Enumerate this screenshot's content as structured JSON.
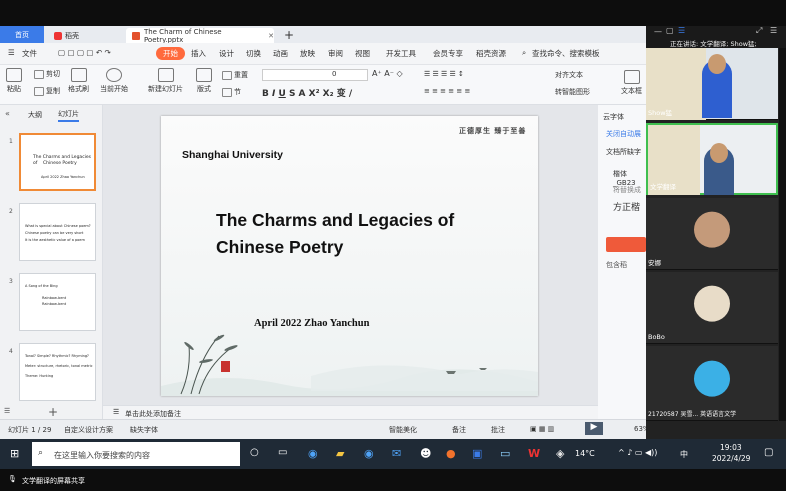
{
  "tabs": {
    "home": "首页",
    "docer": "稻壳",
    "document": "The Charm of Chinese Poetry.pptx"
  },
  "menu": {
    "file": "文件",
    "start": "开始",
    "insert": "插入",
    "design": "设计",
    "transition": "切换",
    "animation": "动画",
    "slideshow": "放映",
    "review": "审阅",
    "view": "视图",
    "devtools": "开发工具",
    "member": "会员专享",
    "resources": "稻壳资源",
    "search": "查找命令、搜索模板"
  },
  "ribbon": {
    "paste": "粘贴",
    "cut": "剪切",
    "copy": "复制",
    "format_painter": "格式刷",
    "play_from_current": "当前开始",
    "new_slide": "新建幻灯片",
    "layout": "版式",
    "reset": "重置",
    "section": "节",
    "font_size": "0",
    "arrange": "对齐文本",
    "smartart": "转智能图形",
    "textbox": "文本框"
  },
  "left_pane": {
    "tab_outline": "大纲",
    "tab_slides": "幻灯片"
  },
  "thumbs": [
    {
      "num": "1",
      "line1": "The Charms and Legacies of",
      "line2": "Chinese Poetry",
      "line3": "April 2022  Zhao Yanchun"
    },
    {
      "num": "2",
      "line1": "What is special about Chinese poem?",
      "line2": "Chinese poetry can be very short",
      "line3": "It is the aesthetic value of a poem"
    },
    {
      "num": "3",
      "line1": "A Song of the Bing",
      "line2": "Rainbow-bent",
      "line3": "Rainbow-bent"
    },
    {
      "num": "4",
      "line1": "Tonal? Simple? Rhythmic? Rhyming?",
      "line2": "Meter: structure, rhetoric, tonal metric",
      "line3": "Theme: Hunting"
    }
  ],
  "slide": {
    "university": "Shanghai University",
    "title_line1": "The Charms and Legacies of",
    "title_line2": "Chinese Poetry",
    "subtitle": "April 2022  Zhao Yanchun",
    "calligraphy": "正德厚生 臻于至善"
  },
  "notes": {
    "placeholder": "单击此处添加备注"
  },
  "right_panel": {
    "font_label": "云字体",
    "close_auto": "关闭自动展",
    "missing_font": "文档所缺字",
    "font_name": "楷体_GB23",
    "replace": "将替换成",
    "sample": "方正楷",
    "contains": "包含稻"
  },
  "status": {
    "slide_counter": "幻灯片 1 / 29",
    "custom_theme": "自定义设计方案",
    "missing_font": "缺失字体",
    "smart_beautify": "智能美化",
    "notes_btn": "备注",
    "comments_btn": "批注",
    "zoom": "63%"
  },
  "taskbar": {
    "search_placeholder": "在这里输入你要搜索的内容",
    "temperature": "14°C",
    "ime": "中",
    "time": "19:03",
    "date": "2022/4/29"
  },
  "share": {
    "label": "文学翻译的屏幕共享"
  },
  "meeting": {
    "speaking_label": "正在讲话: 文学翻译; Show猛;",
    "participants": [
      {
        "name": "Show猛",
        "color": "#3a6ad8"
      },
      {
        "name": "文学翻译",
        "color": "#2f6fb0"
      },
      {
        "name": "安娜",
        "color": "#c49a7a"
      },
      {
        "name": "BoBo",
        "color": "#e8dcc8"
      },
      {
        "name": "21720587 吴雪... 英语语言文学",
        "color": "#3bb0e6"
      }
    ]
  }
}
